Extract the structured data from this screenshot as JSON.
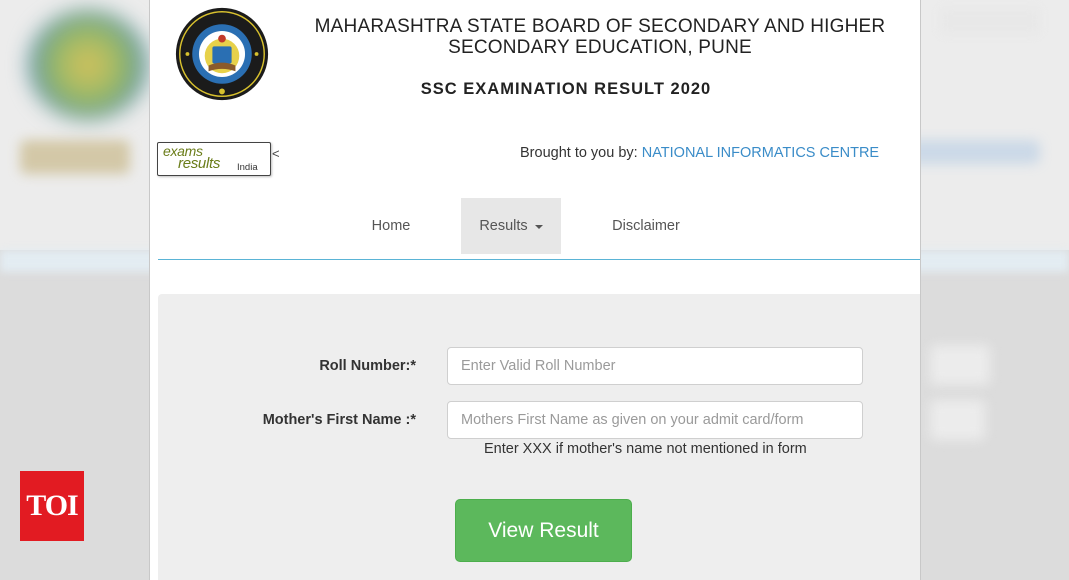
{
  "header": {
    "title": "MAHARASHTRA STATE BOARD OF SECONDARY AND HIGHER SECONDARY EDUCATION, PUNE",
    "subtitle": "SSC EXAMINATION RESULT 2020"
  },
  "partner": {
    "logo_word1": "exams",
    "logo_word2": "results",
    "logo_word3": "India",
    "stray_char": "<",
    "brought_prefix": "Brought to you by:",
    "brought_org": "NATIONAL INFORMATICS CENTRE"
  },
  "nav": {
    "home": "Home",
    "results": "Results",
    "disclaimer": "Disclaimer"
  },
  "form": {
    "roll_label": "Roll Number:*",
    "roll_placeholder": "Enter Valid Roll Number",
    "roll_value": "",
    "mother_label": "Mother's First Name :*",
    "mother_placeholder": "Mothers First Name as given on your admit card/form",
    "mother_value": "",
    "mother_help": "Enter XXX if mother's name not mentioned in form",
    "submit_label": "View Result"
  },
  "watermark": {
    "text": "TOI",
    "color": "#e21b22"
  },
  "colors": {
    "accent": "#3a8cc8",
    "submit": "#5cb85c",
    "nav_line": "#5ab4d6"
  },
  "icons": {
    "emblem": "msbshse-emblem-icon",
    "dropdown": "caret-down-icon"
  }
}
